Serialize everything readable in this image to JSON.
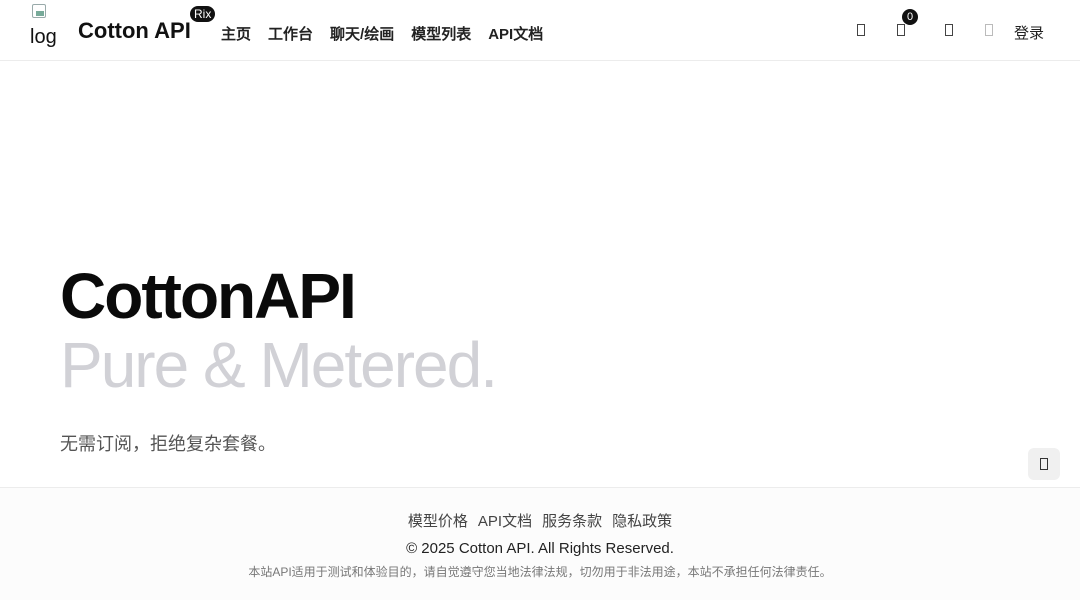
{
  "header": {
    "logo_alt": "log",
    "brand": "Cotton API",
    "brand_badge": "Rix",
    "nav": [
      "主页",
      "工作台",
      "聊天/绘画",
      "模型列表",
      "API文档"
    ],
    "icons": [
      "theme-icon",
      "bell-icon",
      "language-icon",
      "user-icon"
    ],
    "notification_count": "0",
    "login": "登录"
  },
  "hero": {
    "title": "CottonAPI",
    "subtitle": "Pure & Metered.",
    "description": "无需订阅，拒绝复杂套餐。"
  },
  "footer": {
    "links": [
      "模型价格",
      "API文档",
      "服务条款",
      "隐私政策"
    ],
    "copyright": "© 2025 Cotton API. All Rights Reserved.",
    "disclaimer": "本站API适用于测试和体验目的，请自觉遵守您当地法律法规，切勿用于非法用途，本站不承担任何法律责任。"
  },
  "colors": {
    "accent": "#111111",
    "subtitle": "#d1d1d6",
    "border": "#ececec"
  }
}
